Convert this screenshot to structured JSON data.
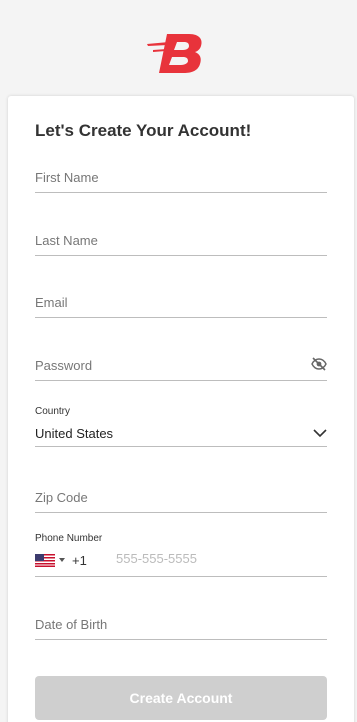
{
  "brand": {
    "accent": "#e8333b"
  },
  "form": {
    "title": "Let's Create Your Account!",
    "first_name": {
      "placeholder": "First Name"
    },
    "last_name": {
      "placeholder": "Last Name"
    },
    "email": {
      "placeholder": "Email"
    },
    "password": {
      "placeholder": "Password",
      "toggle_icon": "eye-slash-icon"
    },
    "country": {
      "label": "Country",
      "value": "United States"
    },
    "zip": {
      "placeholder": "Zip Code"
    },
    "phone": {
      "label": "Phone Number",
      "country_code": "+1",
      "placeholder": "555-555-5555",
      "flag": "us-flag-icon"
    },
    "dob": {
      "placeholder": "Date of Birth"
    },
    "submit_label": "Create Account"
  }
}
